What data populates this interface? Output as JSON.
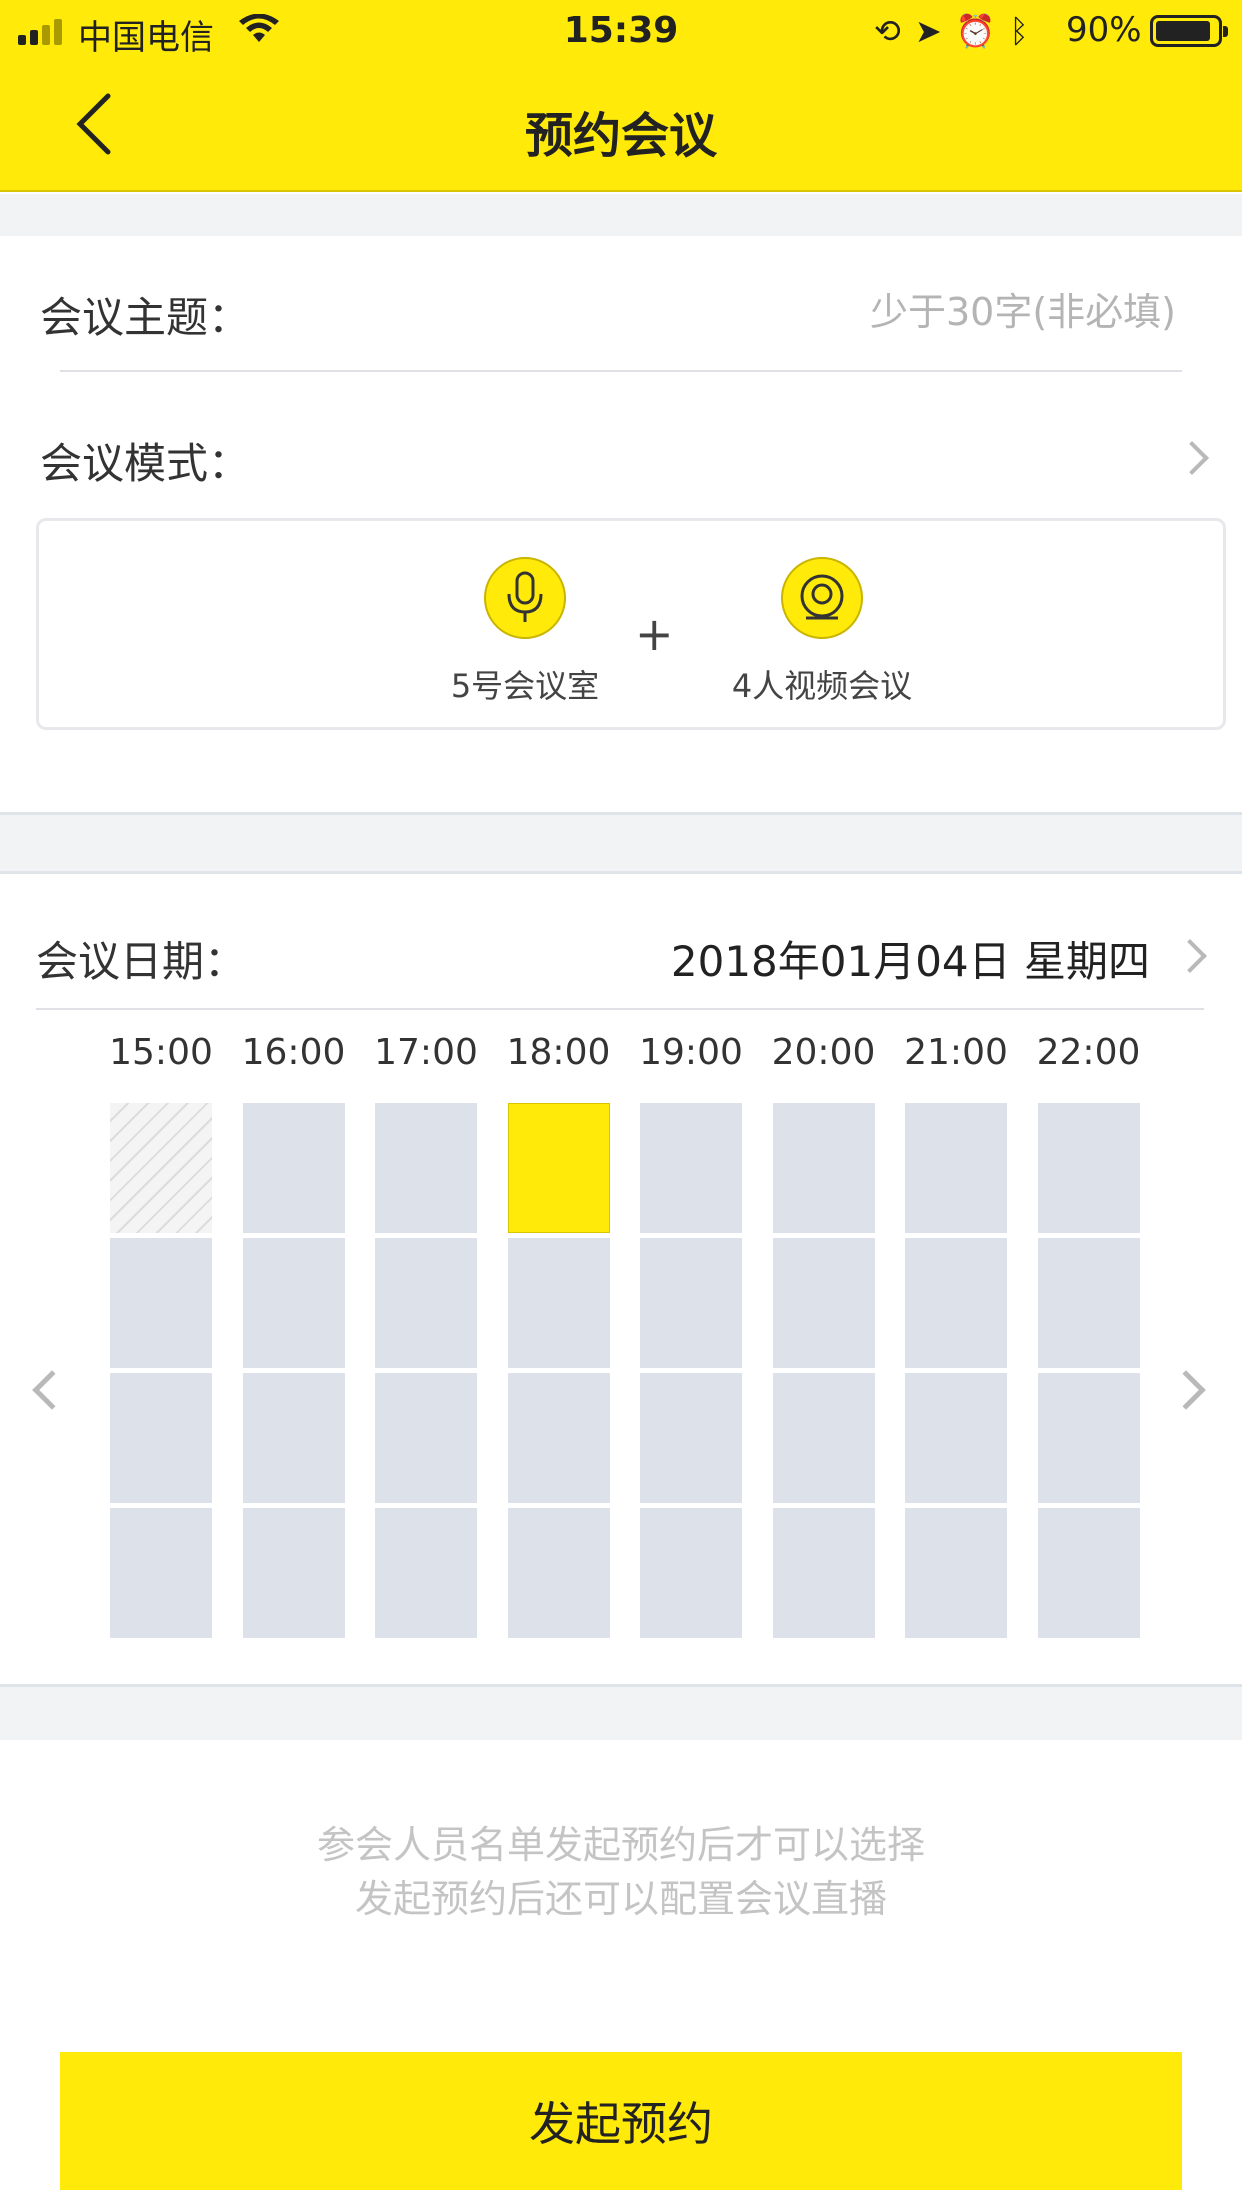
{
  "status_bar": {
    "carrier": "中国电信",
    "time": "15:39",
    "battery": "90%",
    "battery_level": 0.9
  },
  "nav": {
    "title": "预约会议",
    "back_icon": "chevron-left-icon"
  },
  "topic": {
    "label": "会议主题：",
    "placeholder": "少于30字(非必填)",
    "value": ""
  },
  "mode": {
    "label": "会议模式：",
    "items": [
      {
        "label": "5号会议室",
        "icon": "microphone-icon"
      },
      {
        "label": "4人视频会议",
        "icon": "webcam-icon"
      }
    ],
    "plus": "+"
  },
  "date": {
    "label": "会议日期：",
    "value": "2018年01月04日  星期四"
  },
  "schedule": {
    "times": [
      "15:00",
      "16:00",
      "17:00",
      "18:00",
      "19:00",
      "20:00",
      "21:00",
      "22:00"
    ],
    "rows": 4,
    "selected": {
      "column": 3,
      "row": 0
    },
    "unavailable": [
      {
        "column": 0,
        "row": 0
      }
    ]
  },
  "notes": {
    "line1": "参会人员名单发起预约后才可以选择",
    "line2": "发起预约后还可以配置会议直播"
  },
  "submit_label": "发起预约",
  "colors": {
    "accent": "#ffea0a",
    "slot": "#dde2ea",
    "background_gap": "#f2f3f5"
  }
}
